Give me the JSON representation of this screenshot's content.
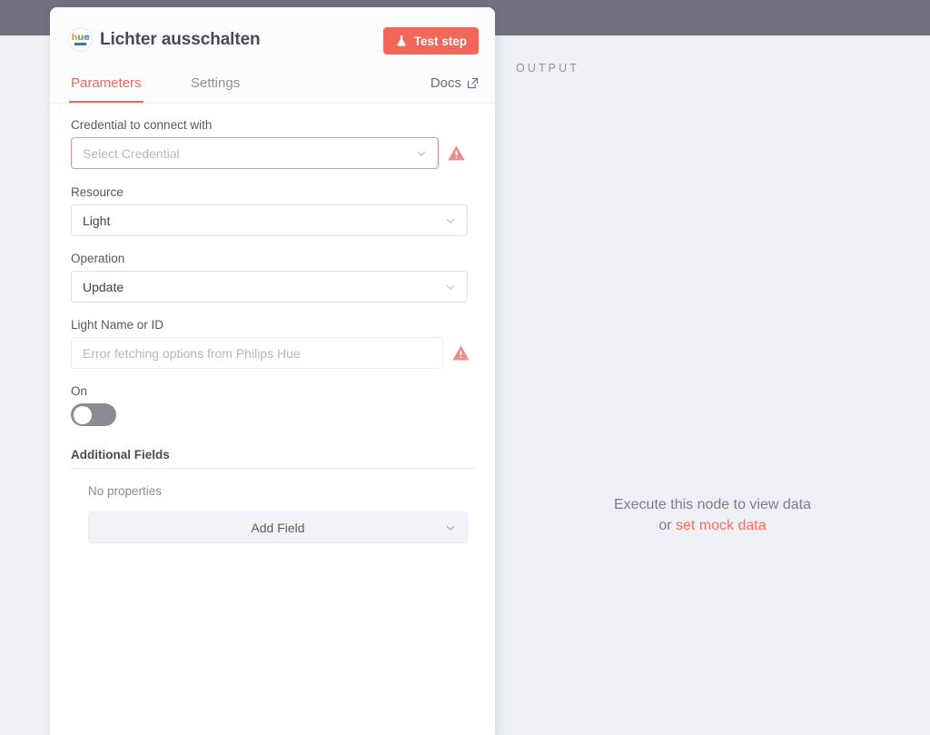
{
  "window": {
    "topbar_color": "#70707e",
    "canvas_bg": "#eef0f5"
  },
  "node_panel": {
    "node_icon_name": "philips-hue-logo-icon",
    "node_icon_text": {
      "l1": "h",
      "l2": "u",
      "l3": "e"
    },
    "title": "Lichter ausschalten",
    "test_step_label": "Test step",
    "accent_color": "#f1685a",
    "tabs": [
      {
        "key": "parameters",
        "label": "Parameters",
        "active": true
      },
      {
        "key": "settings",
        "label": "Settings",
        "active": false
      }
    ],
    "docs_label": "Docs",
    "fields": {
      "credential": {
        "label": "Credential to connect with",
        "placeholder": "Select Credential",
        "value": "",
        "has_error": true
      },
      "resource": {
        "label": "Resource",
        "value": "Light"
      },
      "operation": {
        "label": "Operation",
        "value": "Update"
      },
      "light_name_or_id": {
        "label": "Light Name or ID",
        "placeholder": "Error fetching options from Philips Hue",
        "value": "",
        "has_error": true
      },
      "on_toggle": {
        "label": "On",
        "state": "off"
      }
    },
    "additional_fields": {
      "heading": "Additional Fields",
      "empty_text": "No properties",
      "add_button_label": "Add Field"
    }
  },
  "output_panel": {
    "title": "OUTPUT",
    "empty_line1": "Execute this node to view data",
    "empty_or": "or ",
    "empty_link": "set mock data"
  }
}
